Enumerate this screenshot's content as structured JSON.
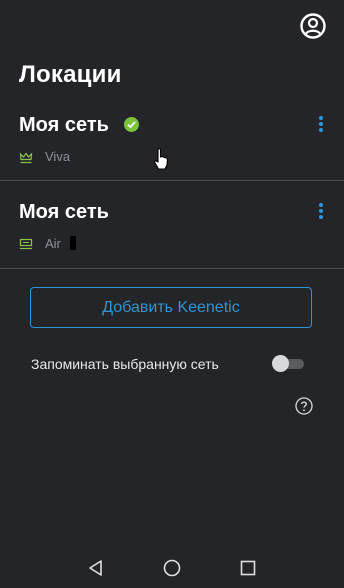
{
  "header": {
    "title": "Локации",
    "account_icon": "account-circle-icon"
  },
  "networks": [
    {
      "name": "Моя сеть",
      "status_icon": "check-circle-icon",
      "status_color": "#7cc33b",
      "model_icon": "router-crown-icon",
      "model": "Viva",
      "menu_icon": "more-vertical-icon"
    },
    {
      "name": "Моя сеть",
      "model_icon": "router-icon",
      "model": "Air",
      "menu_icon": "more-vertical-icon"
    }
  ],
  "actions": {
    "add_label": "Добавить Keenetic"
  },
  "settings": {
    "remember_label": "Запоминать выбранную сеть",
    "remember_enabled": false,
    "help_icon": "help-circle-icon"
  },
  "nav": {
    "back_icon": "back-triangle-icon",
    "home_icon": "home-circle-icon",
    "recents_icon": "recents-square-icon"
  },
  "colors": {
    "background": "#242528",
    "accent": "#2c95d6",
    "success": "#7cc33b",
    "model_icon": "#8bc34a",
    "muted_text": "#8f9196"
  }
}
